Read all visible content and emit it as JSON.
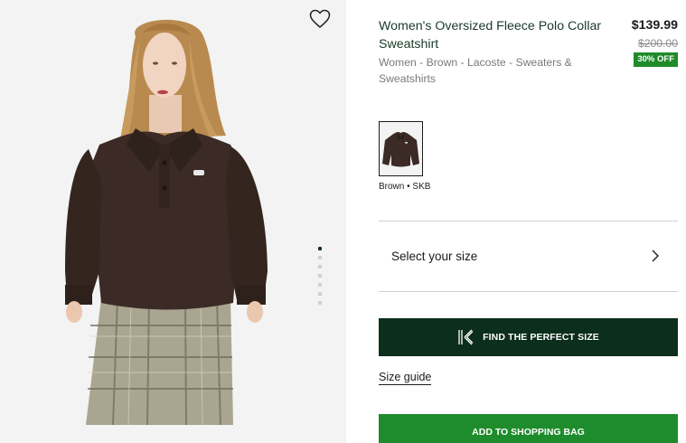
{
  "product": {
    "title": "Women's Oversized Fleece Polo Collar Sweatshirt",
    "breadcrumb": "Women - Brown - Lacoste - Sweaters & Sweatshirts",
    "price": "$139.99",
    "original_price": "$200.00",
    "discount_badge": "30% OFF"
  },
  "gallery": {
    "image_icon": "model-wearing-brown-sweatshirt",
    "wishlist_icon": "heart-outline-icon",
    "image_count": 7,
    "active_image": 1
  },
  "color": {
    "swatch_icon": "brown-sweatshirt-thumbnail",
    "label": "Brown • SKB",
    "hex": "#3b2a25"
  },
  "size": {
    "select_label": "Select your size",
    "chevron_icon": "chevron-right-icon"
  },
  "actions": {
    "find_size_label": "FIND THE PERFECT SIZE",
    "find_size_icon": "k-logo-icon",
    "size_guide_label": "Size guide",
    "add_to_bag_label": "ADD TO SHOPPING BAG"
  },
  "colors": {
    "dark_green": "#0c2e1c",
    "brand_green": "#1e8c2c",
    "discount_green": "#1f8b2b",
    "title_text": "#1a3a2a"
  }
}
